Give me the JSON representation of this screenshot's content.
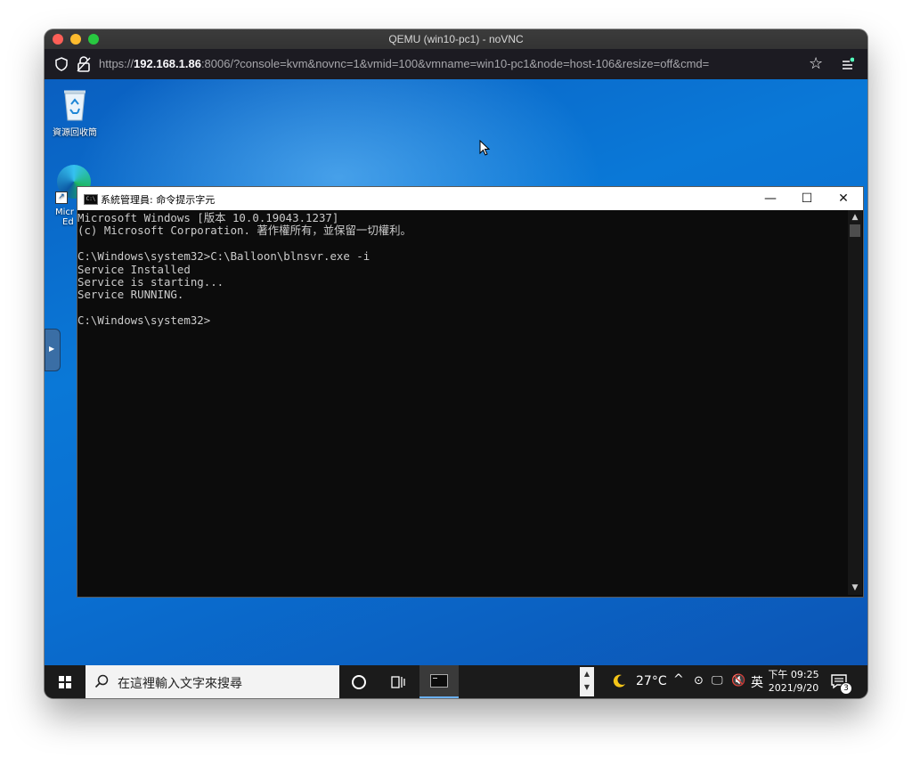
{
  "browser": {
    "window_title": "QEMU (win10-pc1) - noVNC",
    "url_prefix": "https://",
    "url_host": "192.168.1.86",
    "url_rest": ":8006/?console=kvm&novnc=1&vmid=100&vmname=win10-pc1&node=host-106&resize=off&cmd="
  },
  "desktop": {
    "recycle_bin_label": "資源回收筒",
    "edge_label_line1": "Micr",
    "edge_label_line2": "Ed"
  },
  "cmd_window": {
    "title": "系統管理員: 命令提示字元",
    "minimize": "—",
    "maximize": "☐",
    "close": "✕",
    "lines": [
      "Microsoft Windows [版本 10.0.19043.1237]",
      "(c) Microsoft Corporation. 著作權所有，並保留一切權利。",
      "",
      "C:\\Windows\\system32>C:\\Balloon\\blnsvr.exe -i",
      "Service Installed",
      "Service is starting...",
      "Service RUNNING.",
      "",
      "C:\\Windows\\system32>"
    ]
  },
  "taskbar": {
    "search_placeholder": "在這裡輸入文字來搜尋",
    "temperature": "27°C",
    "language": "英",
    "time": "下午 09:25",
    "date": "2021/9/20",
    "notification_count": "3",
    "icons": [
      "windows-start-icon",
      "search-icon",
      "cortana-icon",
      "task-view-icon",
      "command-prompt-icon",
      "weather-moon-icon",
      "network-icon",
      "volume-muted-icon",
      "notification-icon"
    ]
  },
  "colors": {
    "desktop_blue": "#0a78d7",
    "console_bg": "#0c0c0c",
    "console_text": "#cccccc",
    "taskbar": "#1b1b1b",
    "active_task_underline": "#6ab0f3"
  }
}
